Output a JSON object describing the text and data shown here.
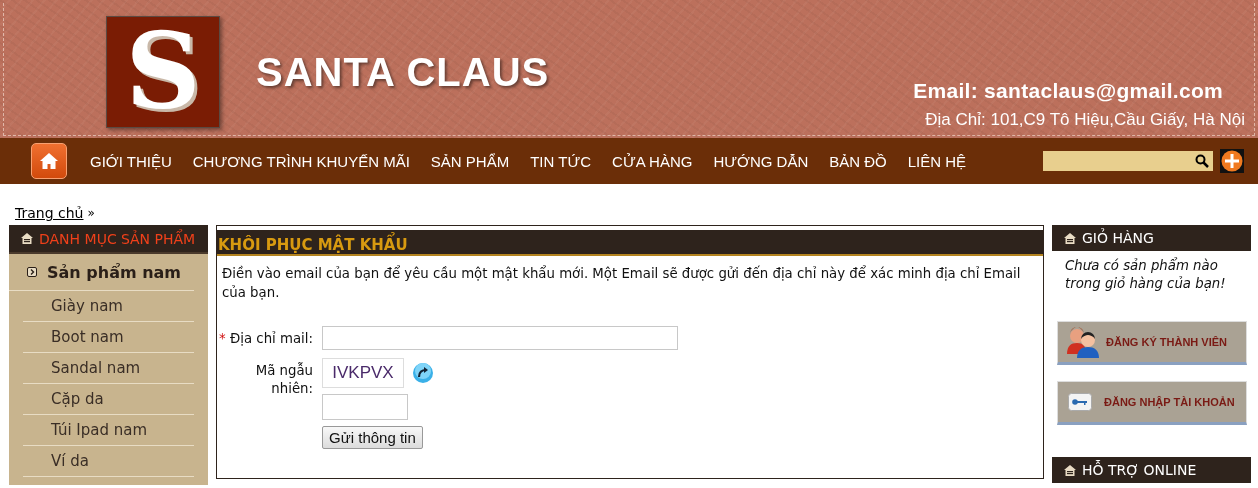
{
  "header": {
    "logo_letter": "S",
    "site_name": "SANTA CLAUS",
    "email": "Email: santaclaus@gmail.com",
    "address": "Địa Chỉ: 101,C9 Tô Hiệu,Cầu Giấy, Hà Nội"
  },
  "nav": {
    "items": [
      "GIỚI THIỆU",
      "CHƯƠNG TRÌNH KHUYẾN MÃI",
      "SẢN PHẨM",
      "TIN TỨC",
      "CỬA HÀNG",
      "HƯỚNG DẪN",
      "BẢN ĐỒ",
      "LIÊN HỆ"
    ]
  },
  "breadcrumb": {
    "link": "Trang chủ",
    "separator": "»"
  },
  "category_menu": {
    "title": "DANH MỤC SẢN PHẨM",
    "items": [
      {
        "label": "Sản phẩm nam",
        "children": [
          {
            "label": "Giày nam"
          },
          {
            "label": "Boot nam"
          },
          {
            "label": "Sandal nam"
          },
          {
            "label": "Cặp da"
          },
          {
            "label": "Túi Ipad nam"
          },
          {
            "label": "Ví da"
          }
        ]
      }
    ]
  },
  "form": {
    "title": "KHÔI PHỤC MẬT KHẨU",
    "intro": "Điền vào email của bạn để yêu cầu một mật khẩu mới. Một Email sẽ được gửi đến địa chỉ này để xác minh địa chỉ Email của bạn.",
    "fields": [
      {
        "kind": "email",
        "marker": "*",
        "label": "Địa chỉ mail:"
      },
      {
        "kind": "captcha",
        "label": "Mã ngẫu nhiên:",
        "code": "IVKPVX"
      }
    ],
    "submit": "Gửi thông tin"
  },
  "cart": {
    "title": "GIỎ HÀNG",
    "empty_text": "Chưa có sản phẩm nào trong giỏ hàng của bạn!"
  },
  "account_buttons": [
    {
      "kind": "register",
      "label": "ĐĂNG KÝ THÀNH VIÊN"
    },
    {
      "kind": "login",
      "label": "ĐĂNG NHẬP TÀI KHOẢN"
    }
  ],
  "support": {
    "title": "HỖ TRỢ ONLINE"
  }
}
